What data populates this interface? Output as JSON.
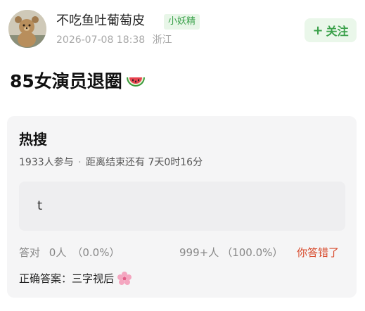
{
  "post": {
    "author": {
      "name": "不吃鱼吐葡萄皮",
      "badge": "小妖精",
      "date": "2026-07-08 18:38",
      "location": "浙江",
      "avatar_icon": "teddy-bear-avatar"
    },
    "follow_button": {
      "icon": "plus-icon",
      "plus": "+",
      "label": "关注"
    },
    "title": "85女演员退圈",
    "title_emoji": "watermelon-icon"
  },
  "poll": {
    "title": "热搜",
    "participants": "1933人参与",
    "separator": "·",
    "countdown": "距离结束还有 7天0时16分",
    "answer": "t",
    "correct_label": "答对",
    "correct_count": "0人",
    "correct_pct": "（0.0%）",
    "total_count": "999+人",
    "total_pct": "（100.0%）",
    "result": "你答错了",
    "correct_answer_label": "正确答案：",
    "correct_answer": "三字视后",
    "answer_emoji": "cherry-blossom-icon"
  },
  "colors": {
    "accent_green": "#3aa14a",
    "error_red": "#d84a2c",
    "card_bg": "#f5f5f6"
  }
}
